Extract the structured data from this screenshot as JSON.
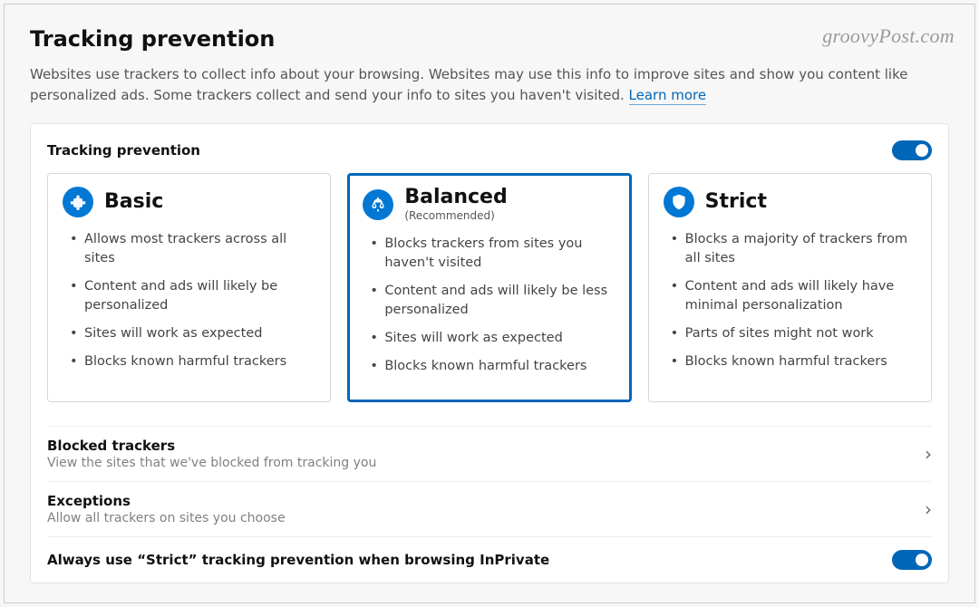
{
  "watermark": "groovyPost.com",
  "page": {
    "title": "Tracking prevention",
    "intro": "Websites use trackers to collect info about your browsing. Websites may use this info to improve sites and show you content like personalized ads. Some trackers collect and send your info to sites you haven't visited. ",
    "learn_more": "Learn more"
  },
  "panel": {
    "title": "Tracking prevention",
    "toggle_on": true
  },
  "cards": {
    "basic": {
      "title": "Basic",
      "items": [
        "Allows most trackers across all sites",
        "Content and ads will likely be personalized",
        "Sites will work as expected",
        "Blocks known harmful trackers"
      ]
    },
    "balanced": {
      "title": "Balanced",
      "subtitle": "(Recommended)",
      "items": [
        "Blocks trackers from sites you haven't visited",
        "Content and ads will likely be less personalized",
        "Sites will work as expected",
        "Blocks known harmful trackers"
      ]
    },
    "strict": {
      "title": "Strict",
      "items": [
        "Blocks a majority of trackers from all sites",
        "Content and ads will likely have minimal personalization",
        "Parts of sites might not work",
        "Blocks known harmful trackers"
      ]
    }
  },
  "rows": {
    "blocked": {
      "title": "Blocked trackers",
      "sub": "View the sites that we've blocked from tracking you"
    },
    "exceptions": {
      "title": "Exceptions",
      "sub": "Allow all trackers on sites you choose"
    },
    "inprivate": {
      "title": "Always use “Strict” tracking prevention when browsing InPrivate",
      "toggle_on": true
    }
  }
}
